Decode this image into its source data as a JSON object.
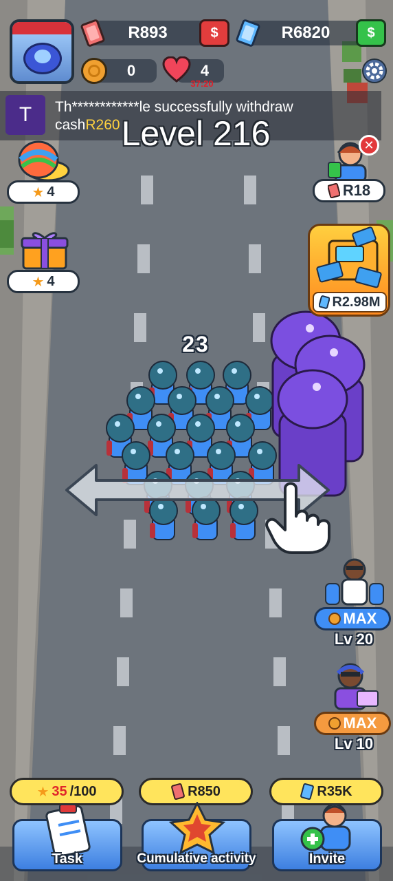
{
  "hud": {
    "cash_red": "R893",
    "cash_blue": "R6820",
    "coins": "0",
    "lives": "4",
    "lives_timer": "37:20"
  },
  "notice": {
    "avatar_letter": "T",
    "text_main": "Th************le successfully withdraw",
    "text_prefix": "cash",
    "text_amount": "R260"
  },
  "level_title": "Level 216",
  "left_items": [
    {
      "name": "spinning-top",
      "count": "4"
    },
    {
      "name": "gift-box",
      "count": "4"
    }
  ],
  "right_items": {
    "reward_top": "R18",
    "atm_value": "R2.98M"
  },
  "crowd_count": "23",
  "upgrades": [
    {
      "label": "MAX",
      "level": "Lv 20",
      "color": "#3f8ef5"
    },
    {
      "label": "MAX",
      "level": "Lv 10",
      "color": "#f59a3f"
    }
  ],
  "bottom_bar": {
    "task_progress_current": "35",
    "task_progress_total": "/100",
    "task_label": "Task",
    "activity_reward": "R850",
    "activity_label": "Cumulative activity",
    "invite_reward": "R35K",
    "invite_label": "Invite"
  },
  "colors": {
    "road": "#6d747c",
    "road_marking": "#b9bec4",
    "accent_yellow": "#ffe45c",
    "cash_red": "#e04848",
    "cash_blue": "#3fa0f0",
    "money_green": "#35c24a",
    "crowd_blue": "#2f6f86",
    "boss_purple": "#6a3fc8",
    "notice_amount": "#ffd23f"
  },
  "icons": [
    "player-avatar",
    "red-banknote",
    "blue-banknote",
    "cash-button",
    "coin",
    "heart",
    "settings-gear",
    "close-x",
    "star",
    "hand-pointer",
    "swipe-arrow"
  ]
}
